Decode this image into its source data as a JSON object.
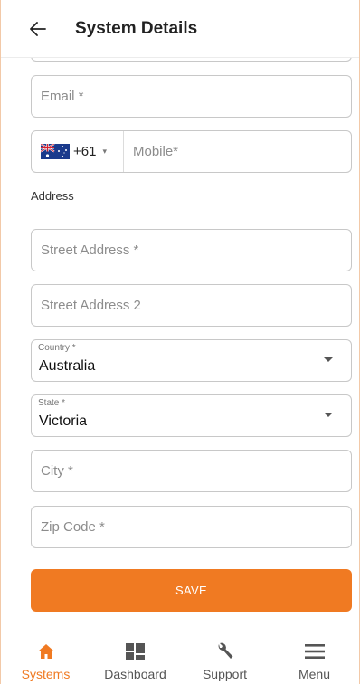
{
  "header": {
    "title": "System Details",
    "back_icon": "arrow-left-icon"
  },
  "form": {
    "email_placeholder": "Email *",
    "phone": {
      "flag_icon": "australia-flag-icon",
      "country_code": "+61",
      "caret": "▾",
      "mobile_placeholder": "Mobile*"
    },
    "address_label": "Address",
    "street_placeholder": "Street Address *",
    "street2_placeholder": "Street Address 2",
    "country": {
      "label": "Country *",
      "value": "Australia"
    },
    "state": {
      "label": "State *",
      "value": "Victoria"
    },
    "city_placeholder": "City *",
    "zip_placeholder": "Zip Code *",
    "save_label": "SAVE"
  },
  "colors": {
    "accent": "#f07a22",
    "border": "#c8c8c8"
  },
  "nav": {
    "items": [
      {
        "label": "Systems",
        "icon": "home-icon",
        "active": true
      },
      {
        "label": "Dashboard",
        "icon": "dashboard-icon",
        "active": false
      },
      {
        "label": "Support",
        "icon": "wrench-icon",
        "active": false
      },
      {
        "label": "Menu",
        "icon": "hamburger-menu-icon",
        "active": false
      }
    ]
  }
}
